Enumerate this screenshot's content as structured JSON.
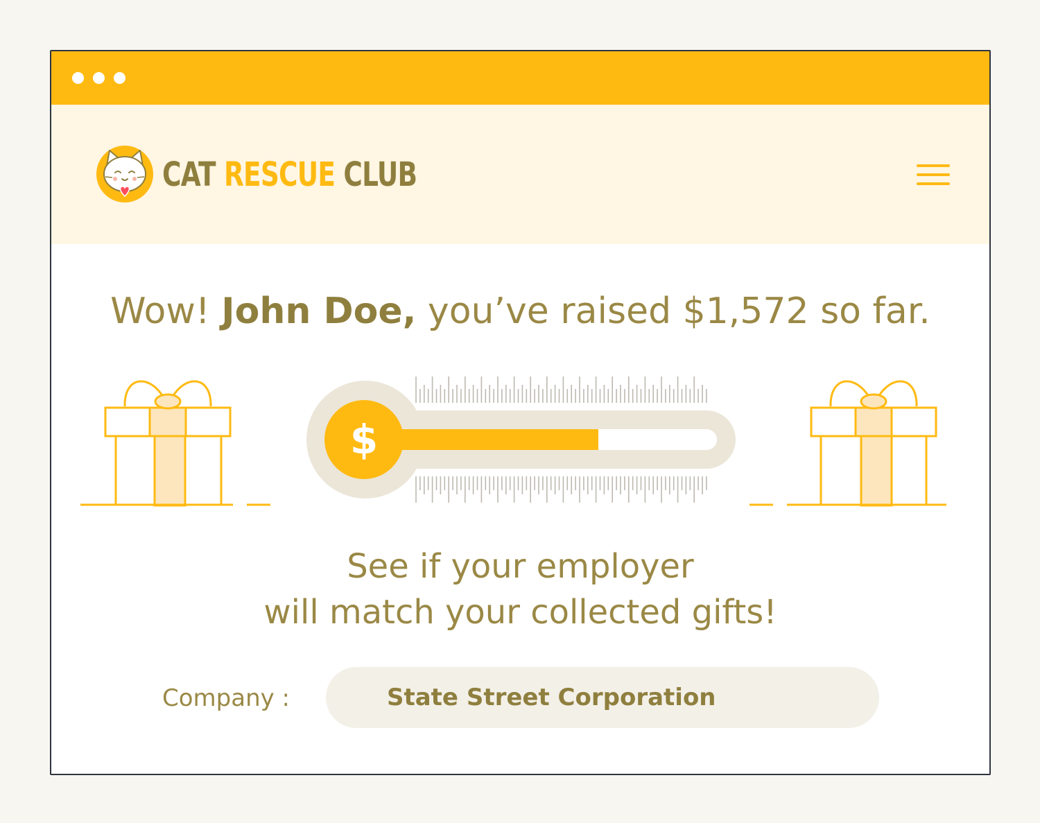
{
  "window": {
    "controls": [
      "dot",
      "dot",
      "dot"
    ]
  },
  "header": {
    "brand": {
      "word1": "CAT",
      "word2": "RESCUE",
      "word3": "CLUB"
    },
    "logo_icon": "cat-face-icon",
    "menu_icon": "hamburger-menu-icon"
  },
  "main": {
    "headline": {
      "prefix": "Wow!",
      "name": "John Doe,",
      "suffix": "you’ve raised $1,572 so far."
    },
    "progress": {
      "icon": "dollar-icon",
      "symbol": "$",
      "fill_fraction": 0.65
    },
    "subtext": {
      "line1": "See if your employer",
      "line2": "will match your collected gifts!"
    },
    "company": {
      "label": "Company :",
      "value": "State Street Corporation"
    }
  },
  "colors": {
    "accent": "#ffba12",
    "accent_light": "#fde6bd",
    "text": "#9a8845",
    "text_bold": "#8f7f3e",
    "header_bg": "#fff6e3",
    "track": "#ebe6d8"
  }
}
